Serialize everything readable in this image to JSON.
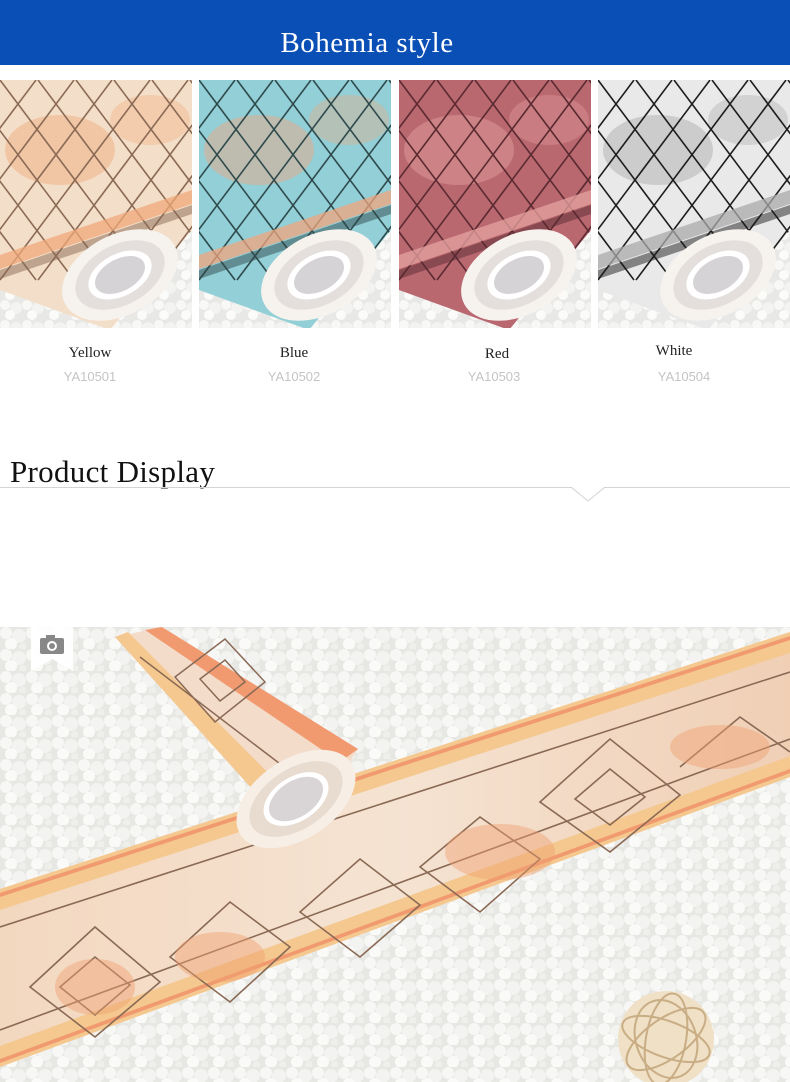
{
  "banner": {
    "title": "Bohemia style"
  },
  "swatches": [
    {
      "name": "Yellow",
      "code": "YA10501",
      "base": "#f3dfc9",
      "accent": "#f0a878",
      "line": "#8a6a55"
    },
    {
      "name": "Blue",
      "code": "YA10502",
      "base": "#93cfd6",
      "accent": "#f2a57e",
      "line": "#2f4a4c"
    },
    {
      "name": "Red",
      "code": "YA10503",
      "base": "#b96870",
      "accent": "#e7a3a0",
      "line": "#5a2a30"
    },
    {
      "name": "White",
      "code": "YA10504",
      "base": "#e9e9e9",
      "accent": "#a9a9a9",
      "line": "#1d1d1d"
    }
  ],
  "section": {
    "title": "Product Display"
  },
  "colors": {
    "banner": "#0a4fb5",
    "rule": "#d4d4d4",
    "code_text": "#c4c4c4"
  },
  "icons": {
    "photo_tag": "camera-icon"
  }
}
